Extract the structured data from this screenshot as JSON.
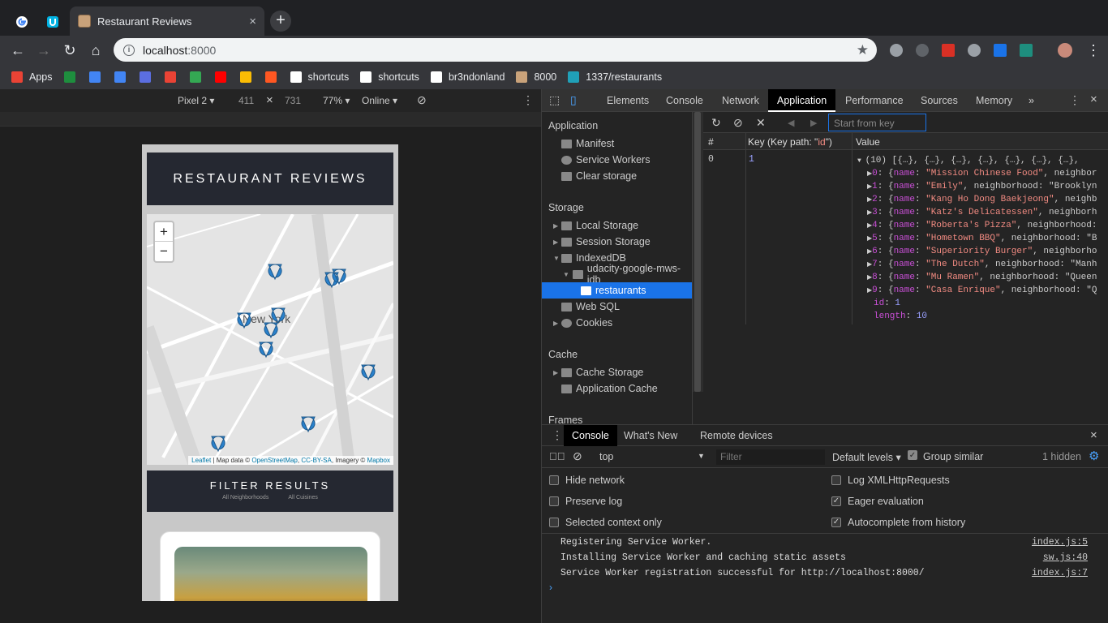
{
  "browser": {
    "tab_title": "Restaurant Reviews",
    "tab_close": "×",
    "new_tab": "+",
    "url_host": "localhost",
    "url_port": ":8000",
    "bookmarks": [
      {
        "label": "Apps",
        "color": "#ea4335"
      },
      {
        "label": "",
        "color": "#1e8e3e"
      },
      {
        "label": "",
        "color": "#4285f4"
      },
      {
        "label": "",
        "color": "#4285f4"
      },
      {
        "label": "",
        "color": "#5b6ee1"
      },
      {
        "label": "",
        "color": "#ea4335"
      },
      {
        "label": "",
        "color": "#34a853"
      },
      {
        "label": "",
        "color": "#ff0000"
      },
      {
        "label": "",
        "color": "#fbbc04"
      },
      {
        "label": "",
        "color": "#ff5722"
      },
      {
        "label": "shortcuts",
        "color": "#ffffff"
      },
      {
        "label": "shortcuts",
        "color": "#ffffff"
      },
      {
        "label": "br3ndonland",
        "color": "#ffffff"
      },
      {
        "label": "8000",
        "color": "#c9a27a"
      },
      {
        "label": "1337/restaurants",
        "color": "#20a0b8"
      }
    ]
  },
  "device_toolbar": {
    "device": "Pixel 2 ▾",
    "width": "411",
    "times": "×",
    "height": "731",
    "zoom": "77% ▾",
    "network": "Online ▾"
  },
  "site": {
    "title": "RESTAURANT REVIEWS",
    "zoom_in": "+",
    "zoom_out": "−",
    "attribution": {
      "leaflet": "Leaflet",
      "sep1": " | Map data © ",
      "osm": "OpenStreetMap",
      "sep2": ", ",
      "license": "CC-BY-SA",
      "sep3": ", Imagery © ",
      "mapbox": "Mapbox"
    },
    "map_label": "New York",
    "filter_title": "FILTER RESULTS",
    "neighborhood_select": "All Neighborhoods",
    "cuisine_select": "All Cuisines"
  },
  "devtools": {
    "tabs": [
      "Elements",
      "Console",
      "Network",
      "Application",
      "Performance",
      "Sources",
      "Memory",
      "»"
    ],
    "active_tab": "Application",
    "sidebar": {
      "application_header": "Application",
      "manifest": "Manifest",
      "service_workers": "Service Workers",
      "clear_storage": "Clear storage",
      "storage_header": "Storage",
      "local_storage": "Local Storage",
      "session_storage": "Session Storage",
      "indexeddb": "IndexedDB",
      "db_name": "udacity-google-mws-idb",
      "store": "restaurants",
      "web_sql": "Web SQL",
      "cookies": "Cookies",
      "cache_header": "Cache",
      "cache_storage": "Cache Storage",
      "application_cache": "Application Cache",
      "frames_header": "Frames"
    },
    "idb": {
      "start_key_placeholder": "Start from key",
      "col_num": "#",
      "col_key": "Key (Key path: \"id\")",
      "col_value": "Value",
      "row_num": "0",
      "row_key": "1",
      "summary": "(10) [{…}, {…}, {…}, {…}, {…}, {…}, {…},",
      "entries": [
        {
          "i": "0",
          "name": "\"Mission Chinese Food\"",
          "rest": ", neighbor"
        },
        {
          "i": "1",
          "name": "\"Emily\"",
          "rest": ", neighborhood: \"Brooklyn"
        },
        {
          "i": "2",
          "name": "\"Kang Ho Dong Baekjeong\"",
          "rest": ", neighb"
        },
        {
          "i": "3",
          "name": "\"Katz's Delicatessen\"",
          "rest": ", neighborh"
        },
        {
          "i": "4",
          "name": "\"Roberta's Pizza\"",
          "rest": ", neighborhood:"
        },
        {
          "i": "5",
          "name": "\"Hometown BBQ\"",
          "rest": ", neighborhood: \"B"
        },
        {
          "i": "6",
          "name": "\"Superiority Burger\"",
          "rest": ", neighborho"
        },
        {
          "i": "7",
          "name": "\"The Dutch\"",
          "rest": ", neighborhood: \"Manh"
        },
        {
          "i": "8",
          "name": "\"Mu Ramen\"",
          "rest": ", neighborhood: \"Queen"
        },
        {
          "i": "9",
          "name": "\"Casa Enrique\"",
          "rest": ", neighborhood: \"Q"
        }
      ],
      "id_label": "id",
      "id_value": "1",
      "length_label": "length",
      "length_value": "10"
    },
    "drawer": {
      "tabs": [
        "Console",
        "What's New",
        "Remote devices"
      ],
      "close": "×",
      "context": "top",
      "filter_placeholder": "Filter",
      "levels": "Default levels ▾",
      "group_similar": "Group similar",
      "hidden": "1 hidden",
      "settings_left": [
        {
          "label": "Hide network",
          "checked": false
        },
        {
          "label": "Preserve log",
          "checked": false
        },
        {
          "label": "Selected context only",
          "checked": false
        }
      ],
      "settings_right": [
        {
          "label": "Log XMLHttpRequests",
          "checked": false
        },
        {
          "label": "Eager evaluation",
          "checked": true
        },
        {
          "label": "Autocomplete from history",
          "checked": true
        }
      ],
      "logs": [
        {
          "text": "Registering Service Worker.",
          "src": "index.js:5"
        },
        {
          "text": "Installing Service Worker and caching static assets",
          "src": "sw.js:40"
        },
        {
          "text": "Service Worker registration successful for http://localhost:8000/",
          "src": "index.js:7"
        }
      ],
      "prompt": "›"
    }
  }
}
